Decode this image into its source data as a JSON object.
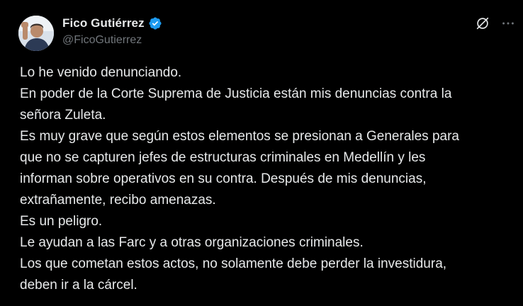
{
  "author": {
    "display_name": "Fico Gutiérrez",
    "handle": "@FicoGutierrez",
    "verified_icon": "verified-badge-icon",
    "verified_color": "#1d9bf0"
  },
  "actions": {
    "grok_icon": "grok-icon",
    "more_icon": "more-options-icon"
  },
  "tweet": {
    "lines": [
      "Lo he venido denunciando.",
      "En poder de la Corte Suprema de Justicia están mis denuncias contra la",
      "señora Zuleta.",
      "Es muy grave que según estos elementos se presionan a Generales para",
      "que no se capturen jefes de estructuras criminales en Medellín y les",
      "informan sobre operativos en su contra. Después de mis denuncias,",
      "extrañamente, recibo amenazas.",
      "Es un peligro.",
      "Le ayudan a las Farc y a otras organizaciones criminales.",
      "Los que cometan estos actos, no solamente debe perder la investidura,",
      "deben ir a la cárcel."
    ]
  },
  "colors": {
    "background": "#000000",
    "text": "#e7e9ea",
    "secondary_text": "#71767b"
  }
}
